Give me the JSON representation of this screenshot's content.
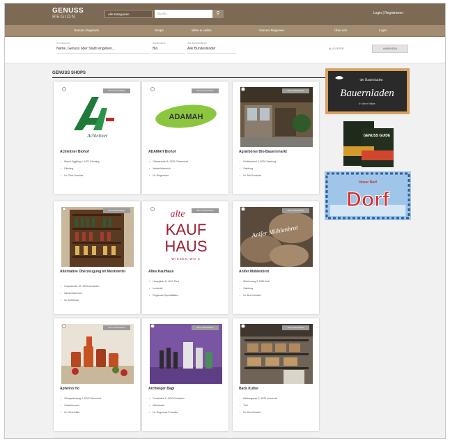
{
  "header": {
    "logo_main": "GENUSS",
    "logo_sub": "REGION",
    "category_select": "Alle Kategorien",
    "search_placeholder": "Suche...",
    "search_icon": "magnifier-icon",
    "login": "Login | Registrieren"
  },
  "nav": {
    "items": [
      "Genuss Regionen",
      "Shops",
      "Wirte & Läden",
      "Genuss Regionen",
      "Über uns",
      "Login"
    ]
  },
  "filter": {
    "search_label": "Genussshop",
    "search_value": "Name, Genuss oder Stadt eingeben...",
    "country_label": "Bundesland",
    "country_value": "Bio",
    "region_label": "Alle Bundesländer",
    "region_value": "Alle Bundesländer",
    "reset": "ALLE FILTER",
    "view_button": "ANWENDEN"
  },
  "section_title": "GENUSS SHOPS",
  "cards": [
    {
      "title": "Achleitner Biohof",
      "badge": "Zum Genussshop",
      "details": [
        "Biohof Egglfing 4, 4971 Eferding",
        "Eferding",
        "Nr. Obst-Gemüse"
      ]
    },
    {
      "title": "ADAMAH Biohof",
      "badge": "Zum Genussshop",
      "details": [
        "Gänserndorf 6, 2282 Glinzendorf",
        "Niederösterreich",
        "Nr. Biogemüse"
      ]
    },
    {
      "title": "Agrarbörse Bio-Bauernmarkt",
      "badge": "Zum Genussshop",
      "details": [
        "Feldbahnhof 3, 5020 Salzburg",
        "Salzburg",
        "Nr. Bio-Produkte"
      ]
    },
    {
      "title": "Alternative Überzeugung im Mostviertel",
      "badge": "Zum Genussshop",
      "details": [
        "Hauptstraße 12, 3300 Amstetten",
        "Niederösterreich",
        "Nr. Apfelmost"
      ]
    },
    {
      "title": "Altes Kaufhaus",
      "badge": "Zum Genussshop",
      "details": [
        "Hauptplatz 8, 4910 Ried",
        "Innviertel",
        "Regionale Spezialitäten"
      ]
    },
    {
      "title": "Anifer Mühlenbrot",
      "badge": "Zum Genussshop",
      "details": [
        "Mühlenweg 3, 5081 Anif",
        "Salzburg",
        "Nr. Brot-Gebäck"
      ]
    },
    {
      "title": "Apfelino Ho",
      "badge": "Zum Genussshop",
      "details": [
        "Obstgartenweg 4, 8273 Ebersdorf",
        "Oststeiermark",
        "Nr. Obst-Säfte"
      ]
    },
    {
      "title": "Archteiger Bagl",
      "badge": "Zum Genussshop",
      "details": [
        "Dorfstraße 5, 4150 Rohrbach",
        "Mühlviertel",
        "Nr. Regionale Produkte"
      ]
    },
    {
      "title": "Back Kultur",
      "badge": "Zum Genussshop",
      "details": [
        "Bäckergasse 2, 6020 Innsbruck",
        "Tirol",
        "Nr. Brot-Gebäck"
      ]
    }
  ],
  "ads": {
    "bauernladen_small": "der Bauernladen",
    "bauernladen_big": "Bauernladen",
    "bauernladen_sub": "In Ihrer Nähe",
    "book": "GENUSS GUIDE",
    "dorf_small": "Unser Dorf",
    "dorf_big": "Dorf"
  },
  "card_logos": {
    "achleitner": "Achleitner",
    "adamah": "ADAMAH",
    "kauf_top": "alte",
    "kauf_mid": "KAUF",
    "kauf_bot": "HAUS",
    "kauf_sub": "WISSEN WO'S",
    "anifer": "Anifer Mühlenbrot"
  }
}
